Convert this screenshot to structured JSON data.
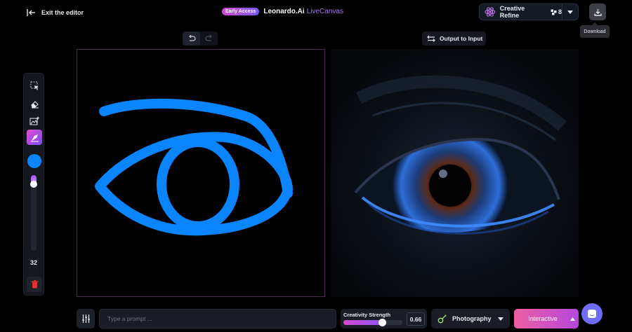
{
  "colors": {
    "accent_purple": "#a57af7",
    "stroke_blue": "#0a84ff",
    "interactive_gradient_start": "#ec5ea0",
    "interactive_gradient_end": "#b548dc",
    "chat_bubble": "#6f6cf7"
  },
  "header": {
    "exit_label": "Exit the editor",
    "badge": "Early Access",
    "app_name": "Leonardo.Ai",
    "app_product": "LiveCanvas",
    "refine_label": "Creative Refine",
    "refine_count": "8",
    "download_tooltip": "Download"
  },
  "toolbar": {
    "output_to_input": "Output to Input"
  },
  "palette": {
    "brush_color": "#0a84ff",
    "brush_size": "32",
    "brush_size_fraction": 0.12
  },
  "bottom": {
    "prompt_placeholder": "Type a prompt ...",
    "strength_label": "Creativity Strength",
    "strength_value": "0.66",
    "strength_fraction": 0.66,
    "style_label": "Photography",
    "interactive_label": "Interactive"
  }
}
